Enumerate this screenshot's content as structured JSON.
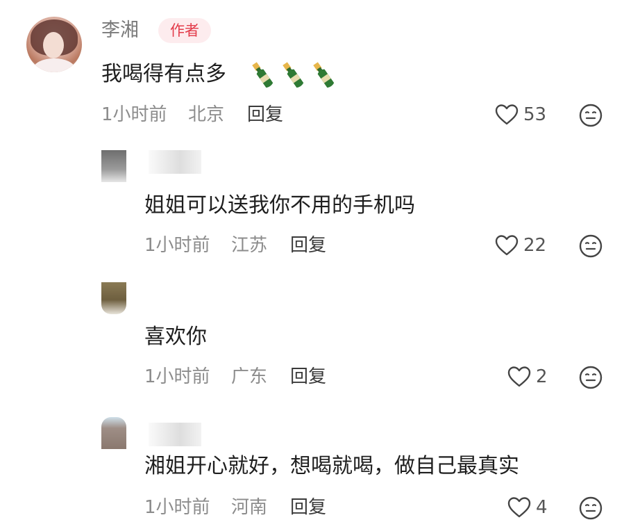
{
  "author": {
    "name": "李湘",
    "badge": "作者",
    "comment": "我喝得有点多",
    "emoji_icons": [
      "champagne-bottle-icon",
      "champagne-bottle-icon",
      "champagne-bottle-icon"
    ],
    "time": "1小时前",
    "location": "北京",
    "reply_label": "回复",
    "likes": "53"
  },
  "replies": [
    {
      "comment": "姐姐可以送我你不用的手机吗",
      "time": "1小时前",
      "location": "江苏",
      "reply_label": "回复",
      "likes": "22"
    },
    {
      "comment": "喜欢你",
      "time": "1小时前",
      "location": "广东",
      "reply_label": "回复",
      "likes": "2"
    },
    {
      "comment": "湘姐开心就好，想喝就喝，做自己最真实",
      "time": "1小时前",
      "location": "河南",
      "reply_label": "回复",
      "likes": "4"
    }
  ],
  "colors": {
    "badge_bg": "#fdecee",
    "badge_text": "#e33b4a",
    "meta_text": "#8c8c8c",
    "comment_text": "#1e1e1e"
  }
}
